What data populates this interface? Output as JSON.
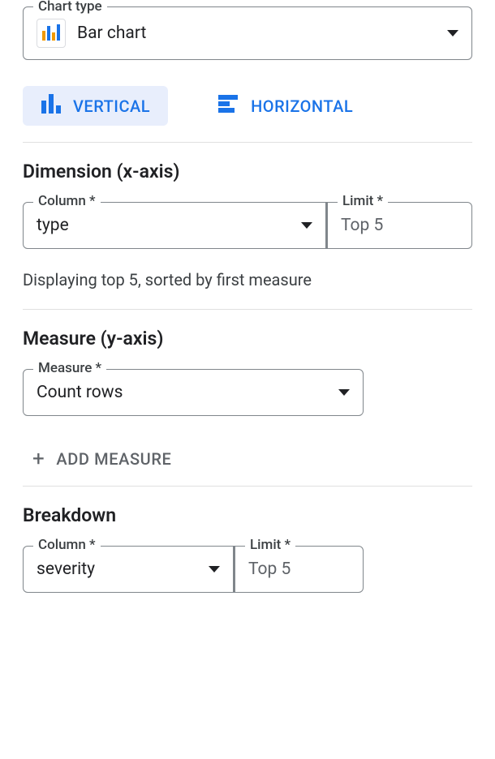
{
  "chartType": {
    "legend": "Chart type",
    "value": "Bar chart"
  },
  "orientation": {
    "vertical": "VERTICAL",
    "horizontal": "HORIZONTAL"
  },
  "dimension": {
    "heading": "Dimension (x-axis)",
    "columnLegend": "Column *",
    "columnValue": "type",
    "limitLegend": "Limit *",
    "limitValue": "Top 5",
    "helper": "Displaying top 5, sorted by first measure"
  },
  "measure": {
    "heading": "Measure (y-axis)",
    "legend": "Measure *",
    "value": "Count rows",
    "addLabel": "ADD MEASURE"
  },
  "breakdown": {
    "heading": "Breakdown",
    "columnLegend": "Column *",
    "columnValue": "severity",
    "limitLegend": "Limit *",
    "limitValue": "Top 5"
  }
}
